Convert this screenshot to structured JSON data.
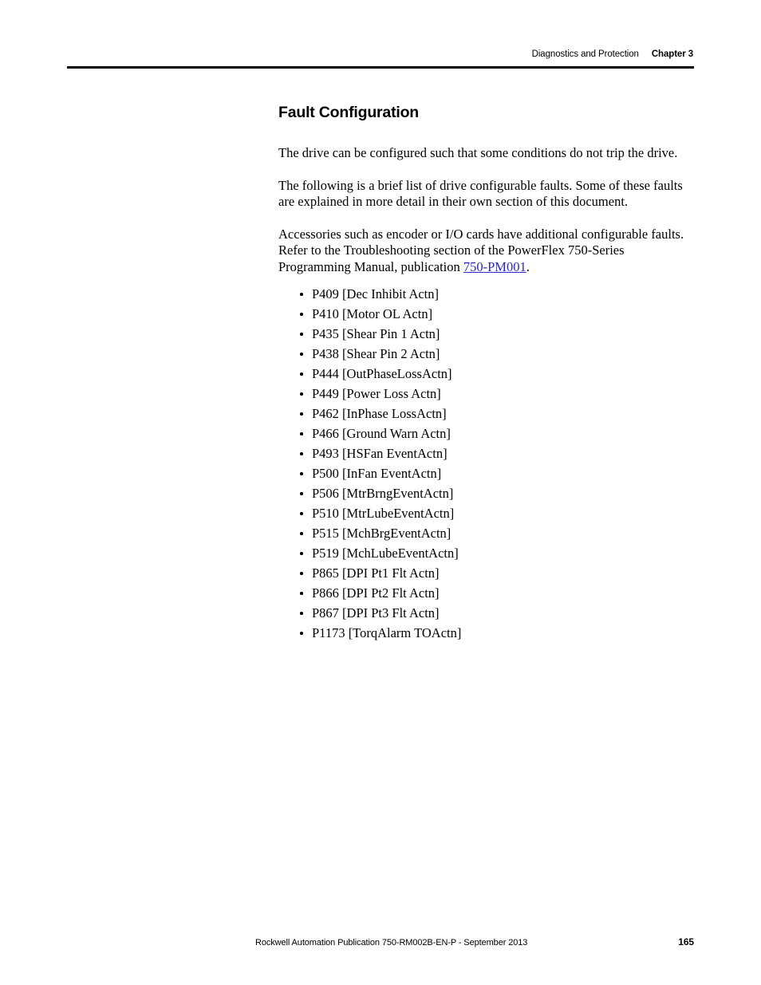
{
  "header": {
    "chapter_label": "Diagnostics and Protection",
    "chapter_number": "Chapter 3"
  },
  "main": {
    "section_title": "Fault Configuration",
    "paragraphs": [
      "The drive can be configured such that some conditions do not trip the drive.",
      "The following is a brief list of drive configurable faults. Some of these faults are explained in more detail in their own section of this document."
    ],
    "accessories_paragraph": {
      "before_link": "Accessories such as encoder or I/O cards have additional configurable faults. Refer to the Troubleshooting section of the PowerFlex 750-Series Programming Manual, publication ",
      "link_text": "750-PM001",
      "after_link": "."
    },
    "fault_list": [
      "P409 [Dec Inhibit Actn]",
      "P410 [Motor OL Actn]",
      "P435 [Shear Pin 1 Actn]",
      "P438 [Shear Pin 2 Actn]",
      "P444 [OutPhaseLossActn]",
      "P449 [Power Loss Actn]",
      "P462 [InPhase LossActn]",
      "P466 [Ground Warn Actn]",
      "P493 [HSFan EventActn]",
      "P500 [InFan EventActn]",
      "P506 [MtrBrngEventActn]",
      "P510 [MtrLubeEventActn]",
      "P515 [MchBrgEventActn]",
      "P519 [MchLubeEventActn]",
      "P865 [DPI Pt1 Flt Actn]",
      "P866 [DPI Pt2 Flt Actn]",
      "P867 [DPI Pt3 Flt Actn]",
      "P1173 [TorqAlarm TOActn]"
    ]
  },
  "footer": {
    "publication": "Rockwell Automation Publication 750-RM002B-EN-P - September 2013",
    "page_number": "165"
  },
  "colors": {
    "link": "#2929cc",
    "text": "#000000",
    "background": "#ffffff"
  }
}
